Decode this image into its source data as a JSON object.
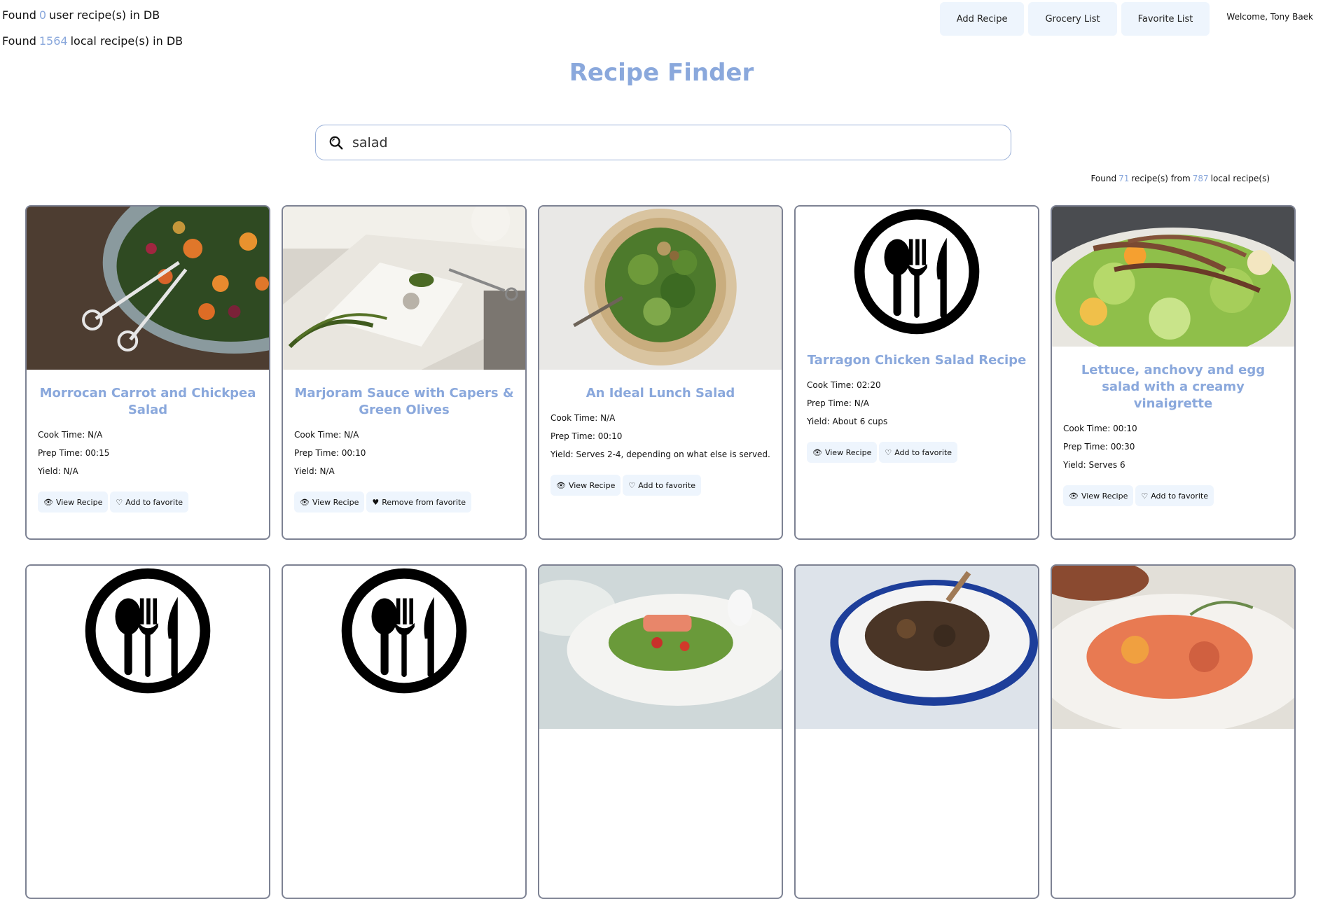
{
  "stats": {
    "user_prefix": "Found",
    "user_count": "0",
    "user_suffix": "user recipe(s) in DB",
    "local_prefix": "Found",
    "local_count": "1564",
    "local_suffix": "local recipe(s) in DB"
  },
  "nav": {
    "add_recipe": "Add Recipe",
    "grocery_list": "Grocery List",
    "favorite_list": "Favorite List",
    "welcome": "Welcome, Tony Baek"
  },
  "title": "Recipe Finder",
  "search": {
    "value": "salad",
    "icon": "search-icon"
  },
  "results": {
    "prefix": "Found",
    "count": "71",
    "middle": "recipe(s) from",
    "total": "787",
    "suffix": "local recipe(s)"
  },
  "labels": {
    "cook_time": "Cook Time:",
    "prep_time": "Prep Time:",
    "yield": "Yield:",
    "view_recipe": "View Recipe",
    "add_favorite": "Add to favorite",
    "remove_favorite": "Remove from favorite"
  },
  "cards": [
    {
      "title": "Morrocan Carrot and Chickpea Salad",
      "cook": "N/A",
      "prep": "00:15",
      "yield": "N/A",
      "favorite": false,
      "image": "carrot-salad-photo"
    },
    {
      "title": "Marjoram Sauce with Capers & Green Olives",
      "cook": "N/A",
      "prep": "00:10",
      "yield": "N/A",
      "favorite": true,
      "image": "herbs-photo"
    },
    {
      "title": "An Ideal Lunch Salad",
      "cook": "N/A",
      "prep": "00:10",
      "yield": "Serves 2-4, depending on what else is served.",
      "favorite": false,
      "image": "green-salad-bowl-photo"
    },
    {
      "title": "Tarragon Chicken Salad Recipe",
      "cook": "02:20",
      "prep": "N/A",
      "yield": "About 6 cups",
      "favorite": false,
      "image": "utensils-placeholder-icon"
    },
    {
      "title": "Lettuce, anchovy and egg salad with a creamy vinaigrette",
      "cook": "00:10",
      "prep": "00:30",
      "yield": "Serves 6",
      "favorite": false,
      "image": "anchovy-salad-photo"
    }
  ],
  "cards_row2_images": [
    "utensils-placeholder-icon",
    "utensils-placeholder-icon",
    "salmon-salad-photo",
    "lamb-chops-photo",
    "smoked-salmon-plate-photo"
  ],
  "colors": {
    "accent": "#8aa8dc",
    "button_bg": "#eef5fd",
    "card_border": "#7d8293"
  }
}
